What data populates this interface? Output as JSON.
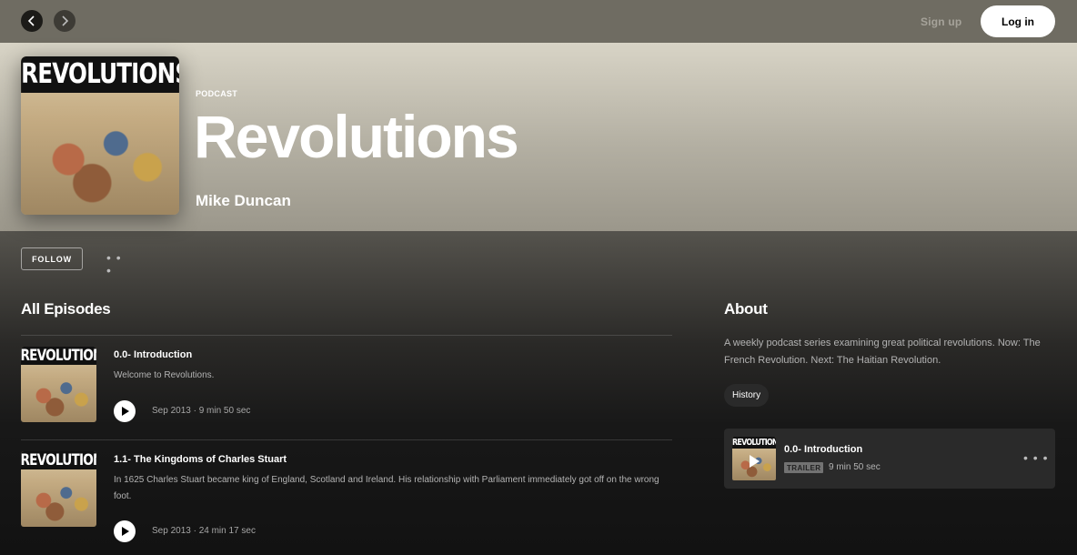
{
  "nav": {
    "back_icon": "chevron-left-icon",
    "forward_icon": "chevron-right-icon",
    "signup_label": "Sign up",
    "login_label": "Log in"
  },
  "podcast": {
    "cover_text": "REVOLUTIONS",
    "type_label": "PODCAST",
    "title": "Revolutions",
    "author": "Mike Duncan",
    "follow_label": "FOLLOW",
    "more_label": "• • •"
  },
  "episodes": {
    "heading": "All Episodes",
    "items": [
      {
        "title": "0.0- Introduction",
        "description": "Welcome to Revolutions.",
        "meta": "Sep 2013 · 9 min 50 sec"
      },
      {
        "title": "1.1- The Kingdoms of Charles Stuart",
        "description": "In 1625 Charles Stuart became king of England, Scotland and Ireland. His relationship with Parliament immediately got off on the wrong foot.",
        "meta": "Sep 2013 · 24 min 17 sec"
      }
    ]
  },
  "about": {
    "heading": "About",
    "description": "A weekly podcast series examining great political revolutions. Now: The French Revolution. Next: The Haitian Revolution.",
    "tag": "History",
    "trailer": {
      "title": "0.0- Introduction",
      "badge": "TRAILER",
      "meta": "9 min 50 sec",
      "more_label": "• • •"
    }
  },
  "colors": {
    "topbar": "#6f6c62",
    "hero_top": "#d8d4c6",
    "background": "#121212",
    "card": "#2a2a2a"
  }
}
